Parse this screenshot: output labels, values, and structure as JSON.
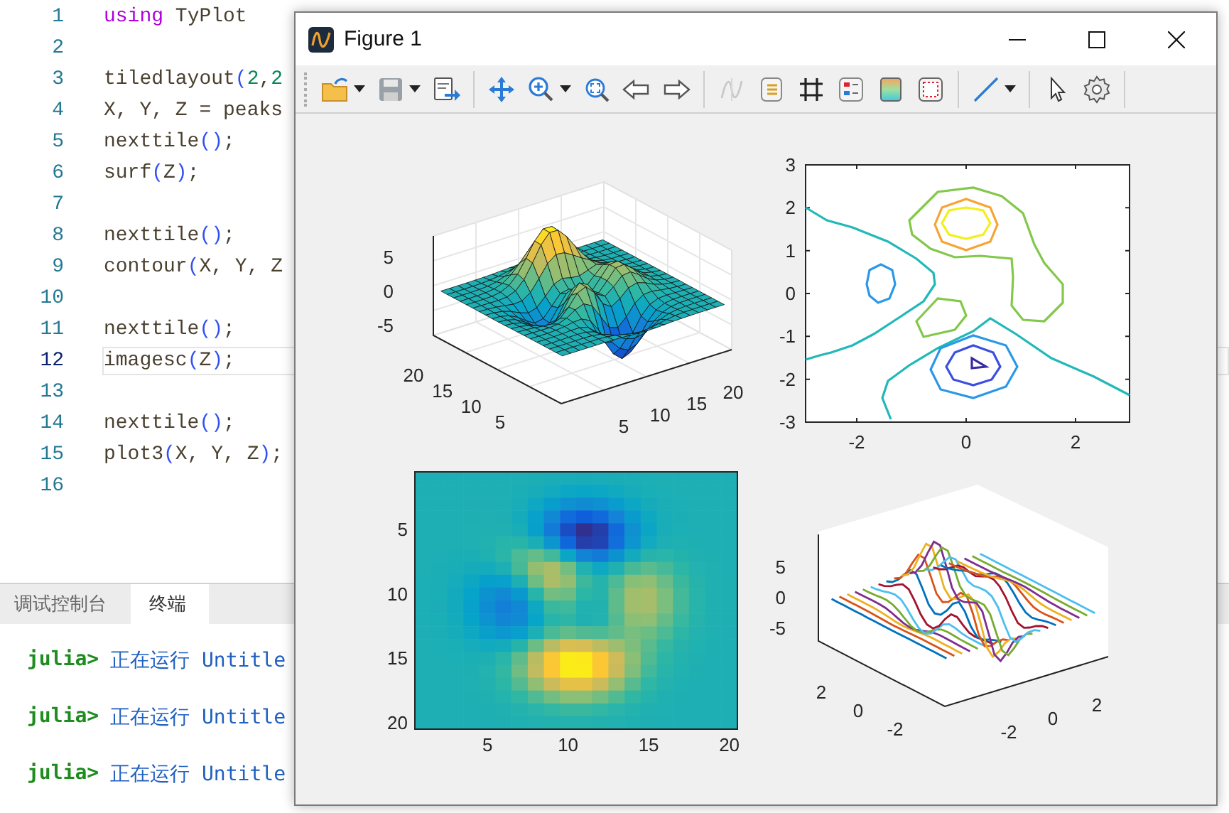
{
  "editor": {
    "lines": [
      {
        "number": "1",
        "current": false,
        "tokens": [
          {
            "kind": "keyword",
            "text": "using"
          },
          {
            "kind": "plain",
            "text": " TyPlot"
          }
        ]
      },
      {
        "number": "2",
        "current": false
      },
      {
        "number": "3",
        "current": false,
        "tokens": [
          {
            "kind": "plain",
            "text": "tiledlayout"
          },
          {
            "kind": "paren",
            "text": "("
          },
          {
            "kind": "number",
            "text": "2"
          },
          {
            "kind": "plain",
            "text": ","
          },
          {
            "kind": "number",
            "text": "2"
          }
        ]
      },
      {
        "number": "4",
        "current": false,
        "tokens": [
          {
            "kind": "plain",
            "text": "X, Y, Z = peaks"
          }
        ]
      },
      {
        "number": "5",
        "current": false,
        "tokens": [
          {
            "kind": "plain",
            "text": "nexttile"
          },
          {
            "kind": "paren",
            "text": "()"
          },
          {
            "kind": "plain",
            "text": ";"
          }
        ]
      },
      {
        "number": "6",
        "current": false,
        "tokens": [
          {
            "kind": "plain",
            "text": "surf"
          },
          {
            "kind": "paren",
            "text": "("
          },
          {
            "kind": "plain",
            "text": "Z"
          },
          {
            "kind": "paren",
            "text": ")"
          },
          {
            "kind": "plain",
            "text": ";"
          }
        ]
      },
      {
        "number": "7",
        "current": false
      },
      {
        "number": "8",
        "current": false,
        "tokens": [
          {
            "kind": "plain",
            "text": "nexttile"
          },
          {
            "kind": "paren",
            "text": "()"
          },
          {
            "kind": "plain",
            "text": ";"
          }
        ]
      },
      {
        "number": "9",
        "current": false,
        "tokens": [
          {
            "kind": "plain",
            "text": "contour"
          },
          {
            "kind": "paren",
            "text": "("
          },
          {
            "kind": "plain",
            "text": "X, Y, Z"
          }
        ]
      },
      {
        "number": "10",
        "current": false
      },
      {
        "number": "11",
        "current": false,
        "tokens": [
          {
            "kind": "plain",
            "text": "nexttile"
          },
          {
            "kind": "paren",
            "text": "()"
          },
          {
            "kind": "plain",
            "text": ";"
          }
        ]
      },
      {
        "number": "12",
        "current": true,
        "tokens": [
          {
            "kind": "plain",
            "text": "imagesc"
          },
          {
            "kind": "paren",
            "text": "("
          },
          {
            "kind": "plain",
            "text": "Z"
          },
          {
            "kind": "paren",
            "text": ")"
          },
          {
            "kind": "plain",
            "text": ";"
          }
        ]
      },
      {
        "number": "13",
        "current": false
      },
      {
        "number": "14",
        "current": false,
        "tokens": [
          {
            "kind": "plain",
            "text": "nexttile"
          },
          {
            "kind": "paren",
            "text": "()"
          },
          {
            "kind": "plain",
            "text": ";"
          }
        ]
      },
      {
        "number": "15",
        "current": false,
        "tokens": [
          {
            "kind": "plain",
            "text": "plot3"
          },
          {
            "kind": "paren",
            "text": "("
          },
          {
            "kind": "plain",
            "text": "X, Y, Z"
          },
          {
            "kind": "paren",
            "text": ")"
          },
          {
            "kind": "plain",
            "text": ";"
          }
        ]
      },
      {
        "number": "16",
        "current": false
      }
    ]
  },
  "panel": {
    "tabs": [
      {
        "label": "调试控制台",
        "selected": false
      },
      {
        "label": "终端",
        "selected": true
      }
    ],
    "terminal": [
      {
        "prompt": "julia>",
        "text": "正在运行 Untitle"
      },
      {
        "prompt": "julia>",
        "text": "正在运行 Untitle"
      },
      {
        "prompt": "julia>",
        "text": "正在运行 Untitle"
      }
    ]
  },
  "figure_window": {
    "title": "Figure 1",
    "toolbar": {
      "groups": [
        [
          {
            "dropdown": true,
            "disabled": false
          },
          {
            "dropdown": true,
            "disabled": false
          },
          {
            "dropdown": false,
            "disabled": false
          }
        ],
        [
          {
            "dropdown": false,
            "disabled": false
          },
          {
            "dropdown": true,
            "disabled": false
          },
          {
            "dropdown": false,
            "disabled": false
          },
          {
            "dropdown": false,
            "disabled": false
          },
          {
            "dropdown": false,
            "disabled": false
          }
        ],
        [
          {
            "dropdown": false,
            "disabled": true
          },
          {
            "dropdown": false,
            "disabled": false
          },
          {
            "dropdown": false,
            "disabled": false
          },
          {
            "dropdown": false,
            "disabled": false
          },
          {
            "dropdown": false,
            "disabled": false
          },
          {
            "dropdown": false,
            "disabled": false
          }
        ],
        [
          {
            "dropdown": true,
            "disabled": false
          }
        ],
        [
          {
            "dropdown": false,
            "disabled": false
          },
          {
            "dropdown": false,
            "disabled": false
          }
        ]
      ]
    },
    "panels": [
      {
        "kind": "surface",
        "x_ticks": [
          "5",
          "10",
          "15",
          "20"
        ],
        "y_ticks": [
          "20",
          "15",
          "10",
          "5"
        ],
        "z_ticks": [
          "5",
          "0",
          "-5"
        ]
      },
      {
        "kind": "contour",
        "x_ticks": [
          "-2",
          "0",
          "2"
        ],
        "y_ticks": [
          "3",
          "2",
          "1",
          "0",
          "-1",
          "-2",
          "-3"
        ]
      },
      {
        "kind": "image",
        "x_ticks": [
          "5",
          "10",
          "15",
          "20"
        ],
        "y_ticks": [
          "5",
          "10",
          "15",
          "20"
        ]
      },
      {
        "kind": "line3d",
        "x_ticks": [
          "-2",
          "0",
          "2"
        ],
        "y_ticks": [
          "2",
          "0",
          "-2"
        ],
        "z_ticks": [
          "5",
          "0",
          "-5"
        ]
      }
    ]
  }
}
